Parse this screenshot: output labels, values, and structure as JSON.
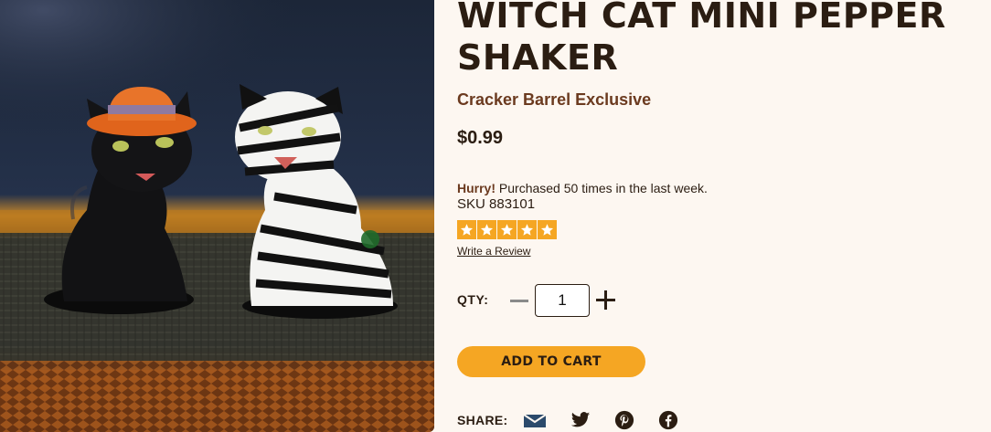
{
  "product": {
    "title": "WITCH CAT MINI PEPPER SHAKER",
    "subtitle": "Cracker Barrel Exclusive",
    "price": "$0.99",
    "hurry_label": "Hurry!",
    "hurry_text": " Purchased 50 times in the last week.",
    "sku": "SKU 883101",
    "rating_stars": 5,
    "write_review": "Write a Review"
  },
  "quantity": {
    "label": "QTY:",
    "value": "1"
  },
  "cart": {
    "button_label": "ADD TO CART"
  },
  "share": {
    "label": "SHARE:",
    "icons": [
      "email-icon",
      "twitter-icon",
      "pinterest-icon",
      "facebook-icon"
    ]
  },
  "colors": {
    "accent": "#f5a623",
    "brand_brown": "#6b3a1f",
    "text_dark": "#2b1d12",
    "background": "#fdf7f1",
    "icon_blue": "#2b4a6b"
  }
}
